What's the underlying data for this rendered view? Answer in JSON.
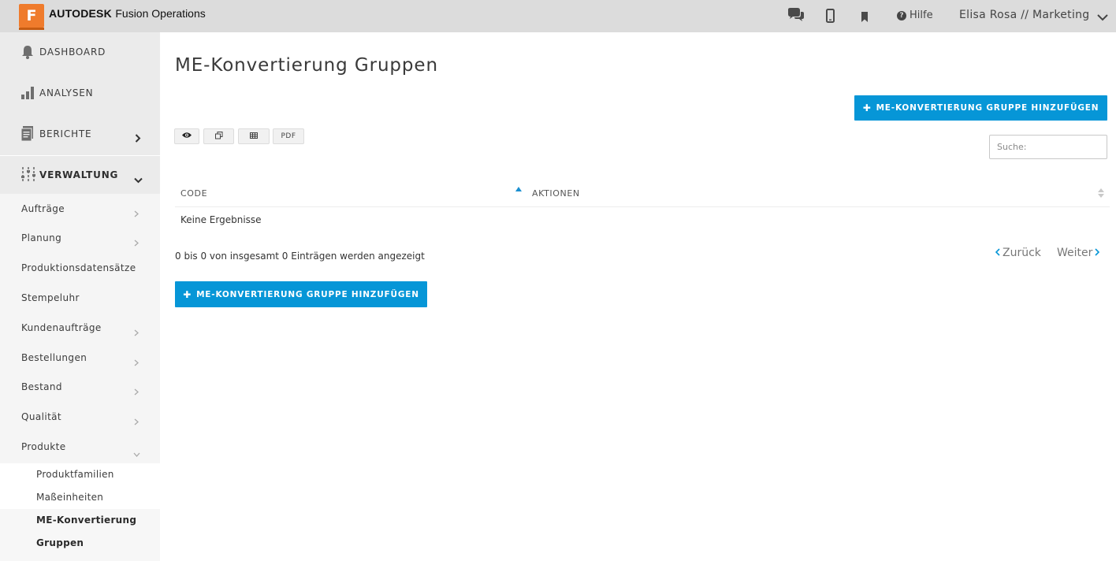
{
  "brand": {
    "logo_letter": "F",
    "company": "AUTODESK",
    "product": "Fusion Operations"
  },
  "topbar": {
    "icons": [
      "chat-icon",
      "mobile-icon",
      "bookmark-icon"
    ],
    "help_label": "Hilfe",
    "user_label": "Elisa Rosa // Marketing"
  },
  "sidebar": {
    "sections": [
      {
        "label": "DASHBOARD",
        "icon": "bell-icon"
      },
      {
        "label": "ANALYSEN",
        "icon": "bar-chart-icon"
      },
      {
        "label": "BERICHTE",
        "icon": "document-icon"
      },
      {
        "label": "VERWALTUNG",
        "icon": "sliders-icon"
      }
    ],
    "items": [
      {
        "label": "Aufträge"
      },
      {
        "label": "Planung"
      },
      {
        "label": "Produktionsdatensätze"
      },
      {
        "label": "Stempeluhr"
      },
      {
        "label": "Kundenaufträge"
      },
      {
        "label": "Bestellungen"
      },
      {
        "label": "Bestand"
      },
      {
        "label": "Qualität"
      },
      {
        "label": "Produkte"
      }
    ],
    "sub_items": [
      {
        "label": "Produktfamilien"
      },
      {
        "label": "Maßeinheiten"
      },
      {
        "label": "ME-Konvertierung Gruppen"
      }
    ]
  },
  "main": {
    "title": "ME-Konvertierung Gruppen",
    "add_button_label": "ME-KONVERTIERUNG GRUPPE HINZUFÜGEN",
    "toolbar": {
      "pdf_label": "PDF"
    },
    "search_placeholder": "Suche:",
    "table": {
      "columns": [
        "CODE",
        "AKTIONEN"
      ],
      "empty_text": "Keine Ergebnisse"
    },
    "info_text": "0 bis 0 von insgesamt 0 Einträgen werden angezeigt",
    "pager": {
      "prev_label": "Zurück",
      "next_label": "Weiter"
    }
  },
  "colors": {
    "accent": "#0696d7",
    "brand_orange": "#ef7b2c",
    "topbar": "#dcdcdc",
    "sidebar": "#f5f5f5"
  }
}
